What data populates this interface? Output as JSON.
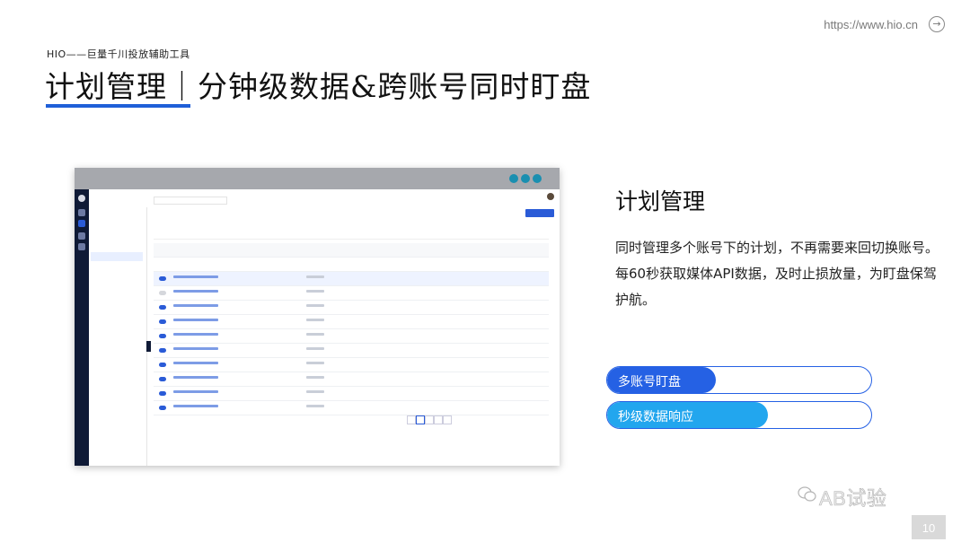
{
  "header": {
    "url": "https://www.hio.cn",
    "subtitle": "HIO——巨量千川投放辅助工具",
    "title": "计划管理｜分钟级数据&跨账号同时盯盘"
  },
  "panel": {
    "section_title": "计划管理",
    "description_1": "同时管理多个账号下的计划，不再需要来回切换账号。",
    "description_2": "每60秒获取媒体API数据，及时止损放量，为盯盘保驾护航。"
  },
  "progress_bars": [
    {
      "label": "多账号盯盘",
      "fill_fraction": 0.41,
      "color": "#2561e4"
    },
    {
      "label": "秒级数据响应",
      "fill_fraction": 0.61,
      "color": "#22a6ee"
    }
  ],
  "watermark": "AB试验",
  "page_number": "10",
  "colors": {
    "accent": "#1f5fd8",
    "bar_blue": "#2561e4",
    "bar_cyan": "#22a6ee"
  }
}
